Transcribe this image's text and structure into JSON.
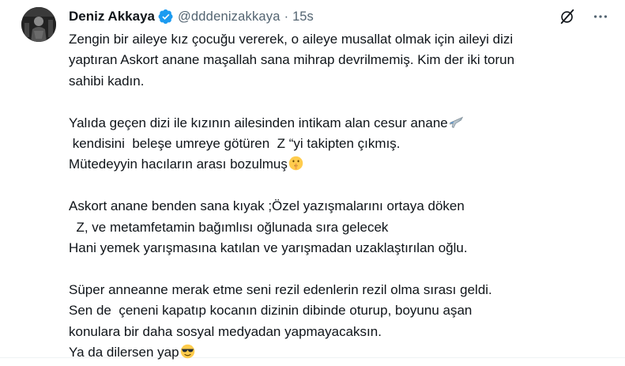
{
  "tweet": {
    "display_name": "Deniz Akkaya",
    "handle": "@dddenizakkaya",
    "separator": "·",
    "time": "15s",
    "paragraphs": [
      [
        "Zengin bir aileye kız çocuğu vererek, o aileye musallat olmak için aileyi dizi",
        "yaptıran Askort anane maşallah sana mihrap devrilmemiş. Kim der iki torun",
        "sahibi kadın."
      ],
      [
        "Yalıda geçen dizi ile kızının ailesinden intikam alan cesur anane",
        " kendisini  beleşe umreye götüren  Z “yi takipten çıkmış.",
        "Mütedeyyin hacıların arası bozulmuş"
      ],
      [
        "Askort anane benden sana kıyak ;Özel yazışmalarını ortaya döken",
        "  Z, ve metamfetamin bağımlısı oğlunada sıra gelecek",
        "Hani yemek yarışmasına katılan ve yarışmadan uzaklaştırılan oğlu."
      ],
      [
        "Süper anneanne merak etme seni rezil edenlerin rezil olma sırası geldi.",
        "Sen de  çeneni kapatıp kocanın dizinin dibinde oturup, boyunu aşan",
        "konulara bir daha sosyal medyadan yapmayacaksın.",
        "Ya da dilersen yap"
      ]
    ],
    "emojis": {
      "airplane": "airplane-emoji",
      "shushing": "shushing-face-emoji",
      "sunglasses": "sunglasses-face-emoji"
    },
    "colors": {
      "text": "#0f1419",
      "secondary": "#536471",
      "verified": "#1d9bf0"
    }
  }
}
